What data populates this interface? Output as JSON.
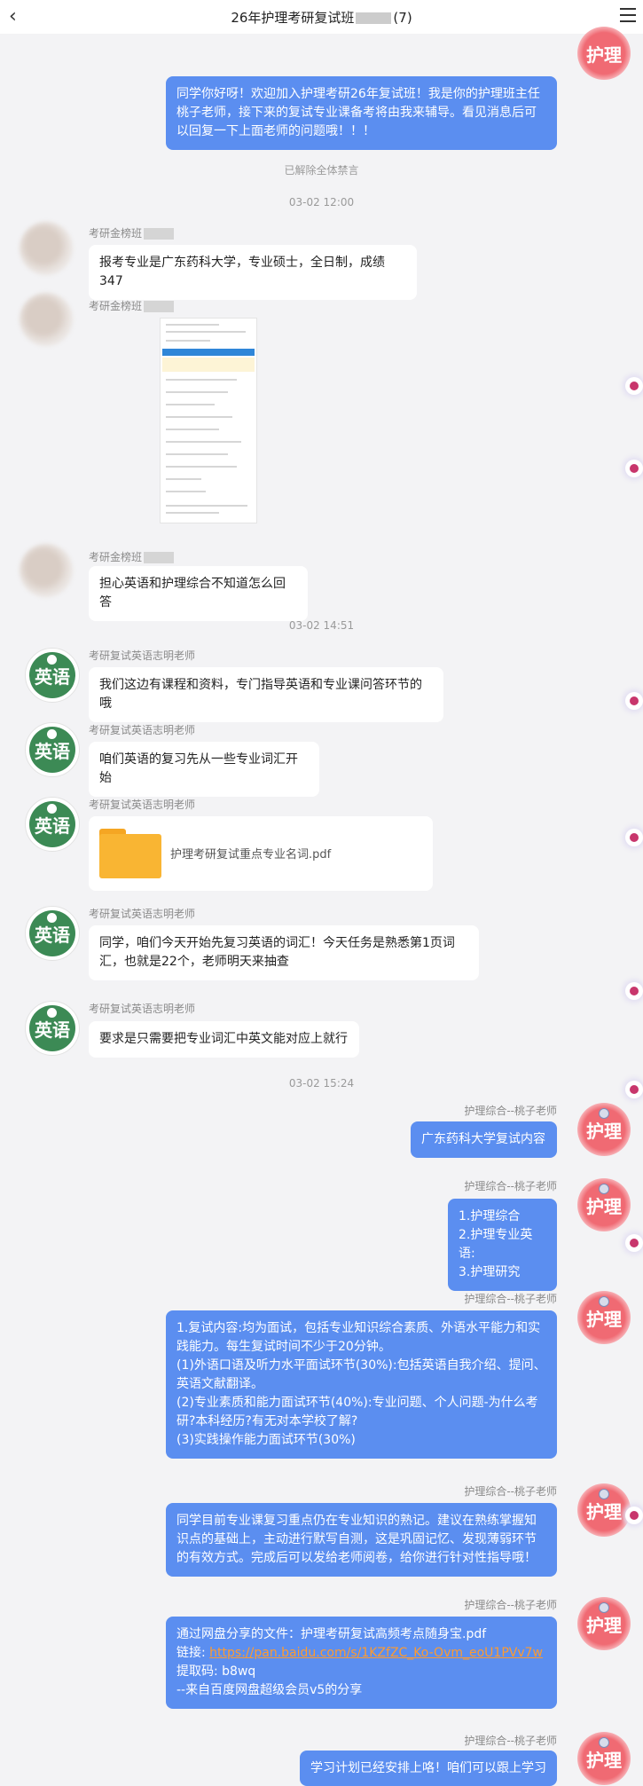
{
  "header": {
    "title_prefix": "26年护理考研复试班",
    "title_suffix": "(7)"
  },
  "messages": {
    "welcome": [
      "同学你好呀！欢迎加入护理考研26年复试班！我是你的护理班主任",
      "桃子老师，接下来的复试专业课备考将由我来辅导。看见消息后可",
      "以回复一下上面老师的问题哦！！！"
    ],
    "unmute": "已解除全体禁言",
    "time1": "03-02 12:00",
    "student_name": "考研金榜班",
    "s1": "报考专业是广东药科大学，专业硕士，全日制，成绩347",
    "s2": "担心英语和护理综合不知道怎么回答",
    "time2": "03-02 14:51",
    "teacher_en": "考研复试英语志明老师",
    "e1": "我们这边有课程和资料，专门指导英语和专业课问答环节的哦",
    "e2": "咱们英语的复习先从一些专业词汇开始",
    "file": "护理考研复试重点专业名词.pdf",
    "e3": [
      "同学，咱们今天开始先复习英语的词汇！今天任务是熟悉第1页词",
      "汇，也就是22个，老师明天来抽查"
    ],
    "e4": "要求是只需要把专业词汇中英文能对应上就行",
    "time3": "03-02 15:24",
    "teacher_nur": "护理综合--桃子老师",
    "n1": "广东药科大学复试内容",
    "n2": [
      "1.护理综合",
      "2.护理专业英语:",
      "3.护理研究"
    ],
    "n3": [
      "1.复试内容:均为面试，包括专业知识综合素质、外语水平能力和实",
      "践能力。每生复试时间不少于20分钟。",
      "(1)外语口语及听力水平面试环节(30%):包括英语自我介绍、提问、",
      "英语文献翻译。",
      "(2)专业素质和能力面试环节(40%):专业问题、个人问题-为什么考",
      "研?本科经历?有无对本学校了解?",
      "(3)实践操作能力面试环节(30%)"
    ],
    "n4": [
      "同学目前专业课复习重点仍在专业知识的熟记。建议在熟练掌握知",
      "识点的基础上，主动进行默写自测，这是巩固记忆、发现薄弱环节",
      "的有效方式。完成后可以发给老师阅卷，给你进行针对性指导哦！"
    ],
    "n5_line1": "通过网盘分享的文件：护理考研复试高频考点随身宝.pdf",
    "n5_link_label": "链接: ",
    "n5_link": "https://pan.baidu.com/s/1KZfZC_Ko-Ovm_eoU1PVv7w",
    "n5_code": "提取码: b8wq",
    "n5_from": "--来自百度网盘超级会员v5的分享",
    "n6": "学习计划已经安排上咯！咱们可以跟上学习"
  },
  "avatars": {
    "english_text": "英语",
    "nursing_text": "护理"
  },
  "colors": {
    "bubble_right": "#5b8ef0",
    "english_avatar": "#3c8a55",
    "nursing_avatar": "#f06a73",
    "link": "#ff9b2f"
  }
}
